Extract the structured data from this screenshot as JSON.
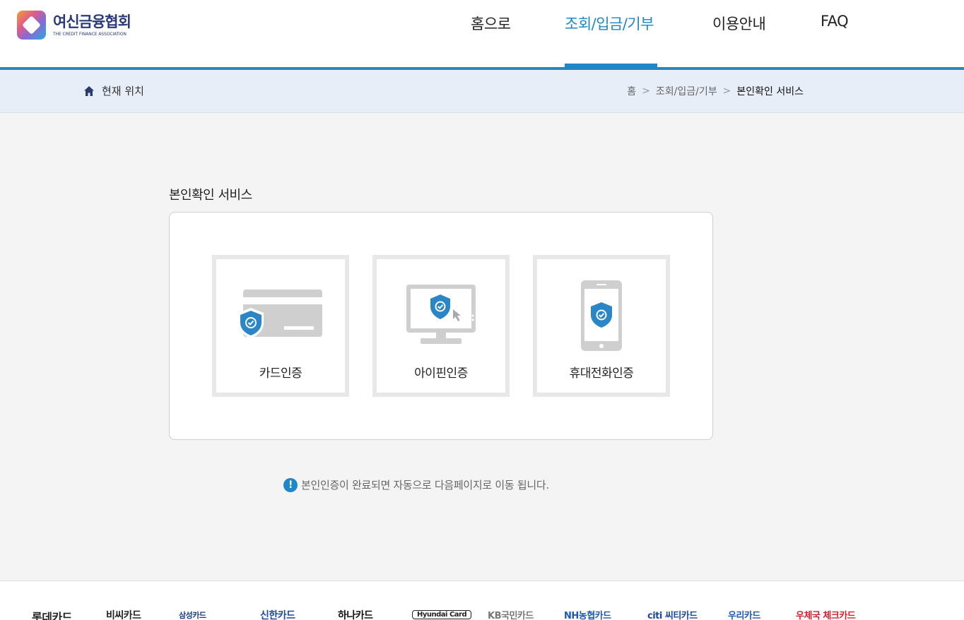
{
  "header": {
    "logo_ko": "여신금융협회",
    "logo_en": "THE CREDIT FINANCE ASSOCIATION",
    "nav": [
      {
        "label": "홈으로"
      },
      {
        "label": "조회/입금/기부"
      },
      {
        "label": "이용안내"
      },
      {
        "label": "FAQ"
      }
    ],
    "active_color": "#1f86c8"
  },
  "breadcrumb": {
    "location_label": "현재 위치",
    "items": [
      "홈",
      "조회/입금/기부",
      "본인확인 서비스"
    ],
    "separator": ">"
  },
  "main": {
    "title": "본인확인 서비스",
    "options": [
      {
        "label": "카드인증",
        "icon": "card-shield-icon"
      },
      {
        "label": "아이핀인증",
        "icon": "monitor-shield-icon"
      },
      {
        "label": "휴대전화인증",
        "icon": "phone-shield-icon"
      }
    ],
    "notice": "본인인증이 완료되면 자동으로 다음페이지로 이동 됩니다."
  },
  "footer": {
    "brands": [
      {
        "label": "롯데카드",
        "color": "#222222"
      },
      {
        "label": "비씨카드",
        "color": "#222222"
      },
      {
        "label": "삼성카드",
        "color": "#1a3a8a"
      },
      {
        "label": "신한카드",
        "color": "#1a4a9a"
      },
      {
        "label": "하나카드",
        "color": "#111111"
      },
      {
        "label": "Hyundai Card",
        "color": "#222222"
      },
      {
        "label": "KB국민카드",
        "color": "#777777"
      },
      {
        "label": "NH농협카드",
        "color": "#1a5ab0"
      },
      {
        "label": "citi 씨티카드",
        "color": "#1a4aa0"
      },
      {
        "label": "우리카드",
        "color": "#1a5ab0"
      },
      {
        "label": "우체국 체크카드",
        "color": "#d0202a"
      }
    ]
  }
}
